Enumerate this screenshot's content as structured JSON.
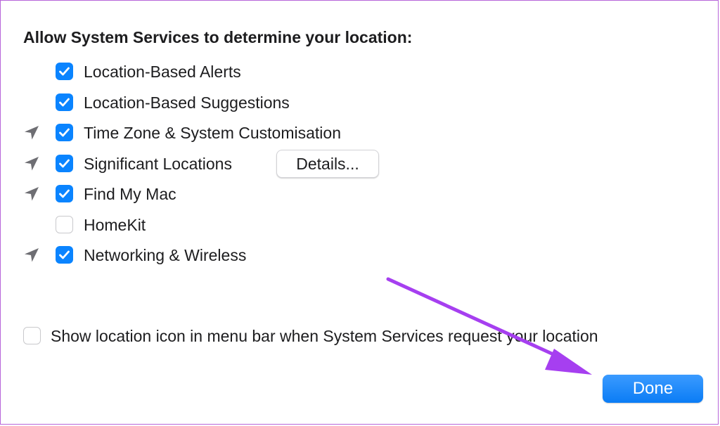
{
  "dialog": {
    "heading": "Allow System Services to determine your location:",
    "services": [
      {
        "label": "Location-Based Alerts",
        "checked": true,
        "recent_use_indicator": false
      },
      {
        "label": "Location-Based Suggestions",
        "checked": true,
        "recent_use_indicator": false
      },
      {
        "label": "Time Zone & System Customisation",
        "checked": true,
        "recent_use_indicator": true
      },
      {
        "label": "Significant Locations",
        "checked": true,
        "recent_use_indicator": true
      },
      {
        "label": "Find My Mac",
        "checked": true,
        "recent_use_indicator": true
      },
      {
        "label": "HomeKit",
        "checked": false,
        "recent_use_indicator": false
      },
      {
        "label": "Networking & Wireless",
        "checked": true,
        "recent_use_indicator": true
      }
    ],
    "details_button": "Details...",
    "show_icon_option": {
      "label": "Show location icon in menu bar when System Services request your location",
      "checked": false
    },
    "done_button": "Done"
  },
  "icons": {
    "recent_use": "location-arrow-icon",
    "checkmark": "checkmark-icon",
    "annotation": "purple-pointer-arrow"
  },
  "colors": {
    "accent": "#0a84ff",
    "annotation_arrow": "#a63ff0",
    "frame_border": "#b765d9",
    "location_arrow": "#6e6e73"
  }
}
